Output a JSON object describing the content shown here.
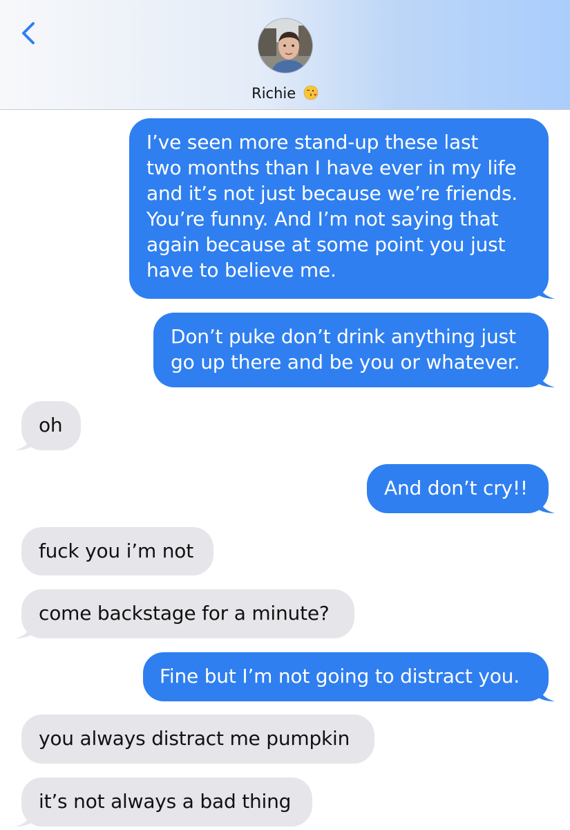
{
  "header": {
    "contact_name": "Richie",
    "emoji": "face-blowing-a-kiss",
    "back_icon": "chevron-left-icon"
  },
  "colors": {
    "sent_bubble": "#2f7ff0",
    "received_bubble": "#e6e5ea",
    "accent": "#2f7ff0"
  },
  "messages": [
    {
      "from": "me",
      "text": "I’ve seen more stand-up these last\ntwo months than I have ever in my life\nand it’s not just because we’re friends.\nYou’re funny. And I’m not saying that\nagain because at some point you just\nhave to believe me."
    },
    {
      "from": "me",
      "text": "Don’t puke don’t drink anything just\ngo up there and be you or whatever."
    },
    {
      "from": "them",
      "text": "oh"
    },
    {
      "from": "me",
      "text": "And don’t cry!!"
    },
    {
      "from": "them",
      "text": "fuck you i’m not"
    },
    {
      "from": "them",
      "text": "come backstage for a minute?"
    },
    {
      "from": "me",
      "text": "Fine but I’m not going to distract you."
    },
    {
      "from": "them",
      "text": "you always distract me pumpkin"
    },
    {
      "from": "them",
      "text": "it’s not always a bad thing"
    }
  ]
}
